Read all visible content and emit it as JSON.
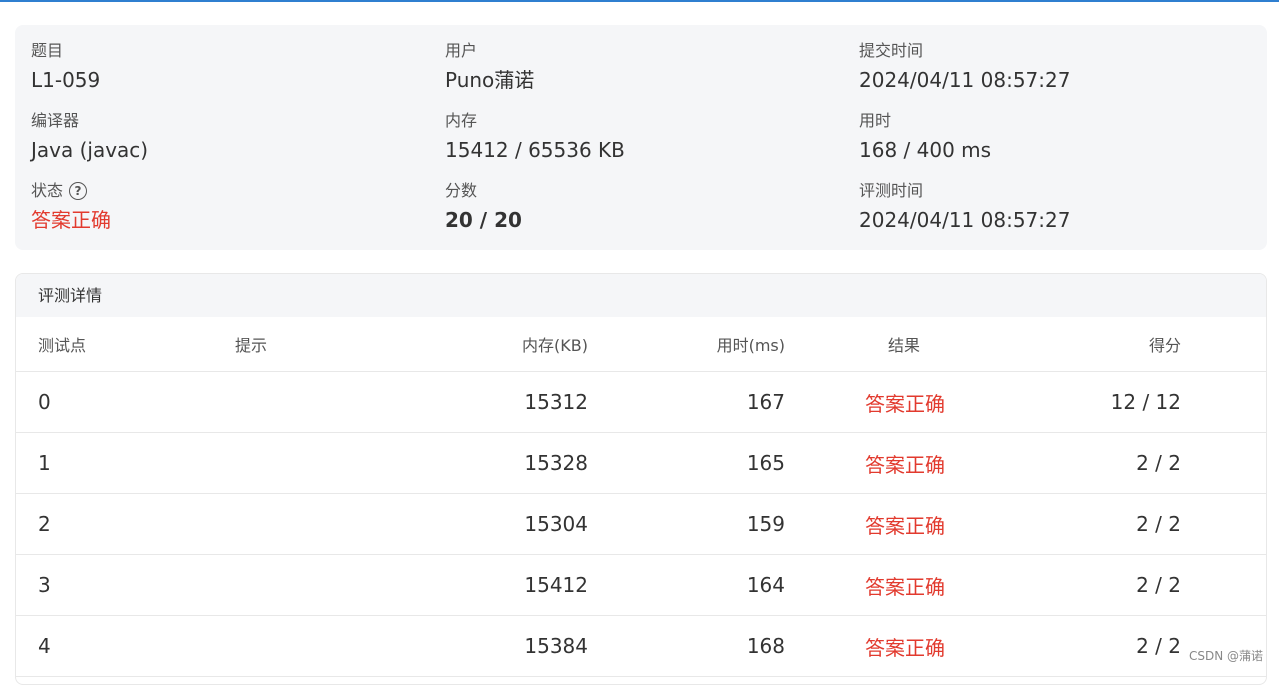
{
  "summary": {
    "problem": {
      "label": "题目",
      "value": "L1-059"
    },
    "user": {
      "label": "用户",
      "value": "Puno蒲诺"
    },
    "submit_time": {
      "label": "提交时间",
      "value": "2024/04/11 08:57:27"
    },
    "compiler": {
      "label": "编译器",
      "value": "Java (javac)"
    },
    "memory": {
      "label": "内存",
      "value": "15412 / 65536 KB"
    },
    "time": {
      "label": "用时",
      "value": "168 / 400 ms"
    },
    "status": {
      "label": "状态",
      "help_icon": "question-circle-icon",
      "help_glyph": "?",
      "value": "答案正确"
    },
    "score": {
      "label": "分数",
      "value": "20 / 20"
    },
    "judge_time": {
      "label": "评测时间",
      "value": "2024/04/11 08:57:27"
    }
  },
  "details": {
    "title": "评测详情",
    "columns": {
      "id": "测试点",
      "hint": "提示",
      "memory": "内存(KB)",
      "time": "用时(ms)",
      "result": "结果",
      "score": "得分"
    },
    "rows": [
      {
        "id": "0",
        "hint": "",
        "memory": "15312",
        "time": "167",
        "result": "答案正确",
        "score": "12 / 12"
      },
      {
        "id": "1",
        "hint": "",
        "memory": "15328",
        "time": "165",
        "result": "答案正确",
        "score": "2 / 2"
      },
      {
        "id": "2",
        "hint": "",
        "memory": "15304",
        "time": "159",
        "result": "答案正确",
        "score": "2 / 2"
      },
      {
        "id": "3",
        "hint": "",
        "memory": "15412",
        "time": "164",
        "result": "答案正确",
        "score": "2 / 2"
      },
      {
        "id": "4",
        "hint": "",
        "memory": "15384",
        "time": "168",
        "result": "答案正确",
        "score": "2 / 2"
      }
    ]
  },
  "watermark": "CSDN @蒲诺",
  "colors": {
    "accent_line": "#2f7fd0",
    "accepted": "#e23a2e",
    "panel_bg": "#f5f6f8"
  }
}
